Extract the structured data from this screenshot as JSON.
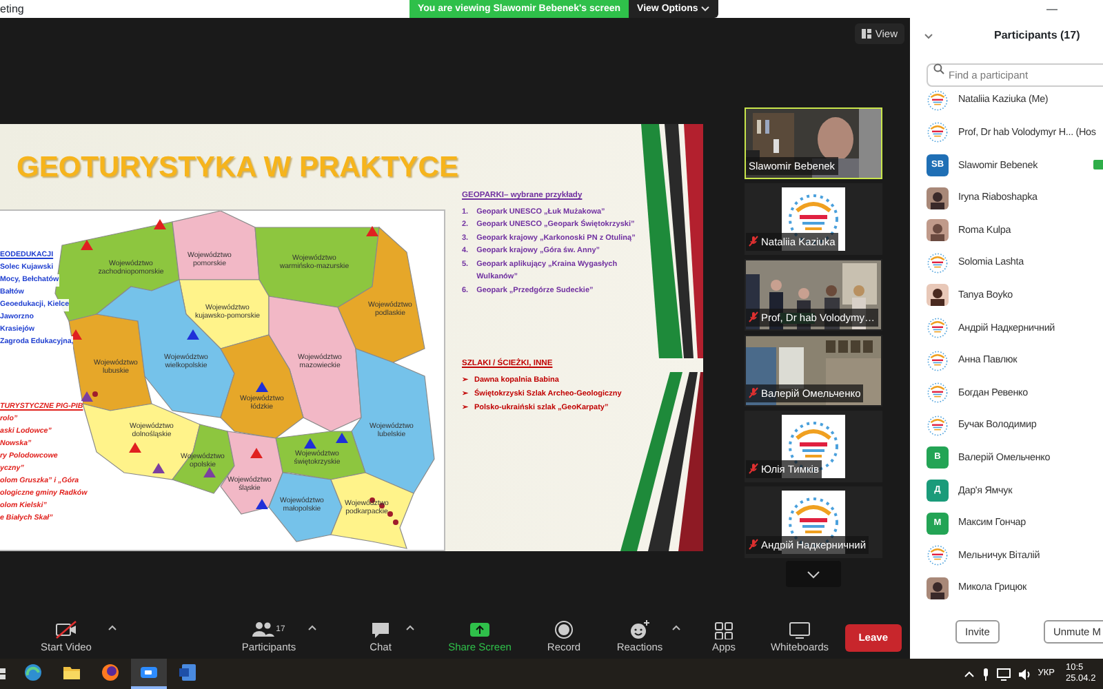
{
  "top_bar": {
    "window_title": "eting",
    "banner": "You are viewing Slawomir Bebenek's screen",
    "view_options": "View Options",
    "minimize": "—"
  },
  "view_button": "View",
  "slide": {
    "title": "GEOTURYSTYKA W PRAKTYCE",
    "regions": [
      {
        "label": "Województwo zachodniopomorskie",
        "color": "#8dc63f"
      },
      {
        "label": "Województwo pomorskie",
        "color": "#f2b8c6"
      },
      {
        "label": "Województwo warmińsko-mazurskie",
        "color": "#8dc63f"
      },
      {
        "label": "Województwo kujawsko-pomorskie",
        "color": "#fff38a"
      },
      {
        "label": "Województwo podlaskie",
        "color": "#e6a729"
      },
      {
        "label": "Województwo lubuskie",
        "color": "#e6a729"
      },
      {
        "label": "Województwo wielkopolskie",
        "color": "#75c2ea"
      },
      {
        "label": "Województwo mazowieckie",
        "color": "#f2b8c6"
      },
      {
        "label": "Województwo łódzkie",
        "color": "#e6a729"
      },
      {
        "label": "Województwo dolnośląskie",
        "color": "#fff38a"
      },
      {
        "label": "Województwo lubelskie",
        "color": "#75c2ea"
      },
      {
        "label": "Województwo opolskie",
        "color": "#8dc63f"
      },
      {
        "label": "Województwo świętokrzyskie",
        "color": "#8dc63f"
      },
      {
        "label": "Województwo śląskie",
        "color": "#f2b8c6"
      },
      {
        "label": "Województwo małopolskie",
        "color": "#75c2ea"
      },
      {
        "label": "Województwo podkarpackie",
        "color": "#fff38a"
      }
    ],
    "left_blue": {
      "heading": "EODEDUKACJI",
      "items": [
        "Solec Kujawski",
        "Mocy, Bełchatów",
        "Bałtów",
        "Geoedukacji, Kielce",
        "Jaworzno",
        "Krasiejów",
        "Zagroda Edukacyjna,"
      ]
    },
    "left_red": {
      "heading": "TURYSTYCZNE PIG-PIB",
      "items": [
        "rolo”",
        "aski Lodowce”",
        "Nowska”",
        "ry Polodowcowe",
        "yczny”",
        "olom Gruszka” i „Góra",
        "ologiczne gminy Radków",
        "olom Kielski”",
        "e Białych Skał”"
      ]
    },
    "geoparks": {
      "heading": "GEOPARKI– wybrane przykłady",
      "items": [
        {
          "number": "1.",
          "text": "Geopark UNESCO „Łuk Mużakowa”"
        },
        {
          "number": "2.",
          "text": "Geopark UNESCO „Geopark Świętokrzyski”"
        },
        {
          "number": "3.",
          "text": "Geopark krajowy „Karkonoski PN z Otuliną”"
        },
        {
          "number": "4.",
          "text": "Geopark krajowy „Góra św. Anny”"
        },
        {
          "number": "5.",
          "text": "Geopark aplikujący „Kraina Wygasłych Wulkanów”"
        },
        {
          "number": "6.",
          "text": "Geopark „Przedgórze Sudeckie”"
        }
      ]
    },
    "trails": {
      "heading": "SZLAKI / ŚCIEŻKI, INNE",
      "items": [
        {
          "marker": "➢",
          "text": "Dawna kopalnia Babina"
        },
        {
          "marker": "➢",
          "text": "Świętokrzyski Szlak Archeo-Geologiczny"
        },
        {
          "marker": "➢",
          "text": "Polsko-ukraiński szlak „GeoKarpaty”"
        }
      ]
    }
  },
  "thumbnails": [
    {
      "name": "Slawomir Bebenek",
      "kind": "video",
      "active": true,
      "muted": false
    },
    {
      "name": "Nataliia Kaziuka",
      "kind": "logo",
      "active": false,
      "muted": true
    },
    {
      "name": "Prof, Dr hab Volodymy…",
      "kind": "video",
      "active": false,
      "muted": true
    },
    {
      "name": "Валерій Омельченко",
      "kind": "video",
      "active": false,
      "muted": true
    },
    {
      "name": "Юлія Тимків",
      "kind": "logo",
      "active": false,
      "muted": true
    },
    {
      "name": "Андрій Надкерничний",
      "kind": "logo",
      "active": false,
      "muted": true
    }
  ],
  "participants": {
    "title": "Participants (17)",
    "search": {
      "placeholder": "Find a participant"
    },
    "items": [
      {
        "name": "Nataliia Kaziuka (Me)",
        "kind": "logo",
        "video_on": false
      },
      {
        "name": "Prof, Dr hab Volodymyr H... (Hos",
        "kind": "logo",
        "video_on": false
      },
      {
        "name": "Slawomir Bebenek",
        "kind": "initials",
        "initials": "SB",
        "color": "#1f6fb5",
        "video_on": true
      },
      {
        "name": "Iryna Riaboshapka",
        "video_on": false
      },
      {
        "name": "Roma Kulpa",
        "video_on": false
      },
      {
        "name": "Solomia Lashta",
        "kind": "logo",
        "video_on": false
      },
      {
        "name": "Tanya Boyko",
        "video_on": false
      },
      {
        "name": "Андрій Надкерничний",
        "kind": "logo",
        "video_on": false
      },
      {
        "name": "Анна Павлюк",
        "kind": "logo",
        "video_on": false
      },
      {
        "name": "Богдан Ревенко",
        "kind": "logo",
        "video_on": false
      },
      {
        "name": "Бучак Володимир",
        "kind": "logo",
        "video_on": false
      },
      {
        "name": "Валерій Омельченко",
        "kind": "initials",
        "initials": "В",
        "color": "#23a455",
        "video_on": false
      },
      {
        "name": "Дар'я Ямчук",
        "kind": "initials",
        "initials": "Д",
        "color": "#1a9b7a",
        "video_on": false
      },
      {
        "name": "Максим Гончар",
        "kind": "initials",
        "initials": "М",
        "color": "#23a455",
        "video_on": false
      },
      {
        "name": "Мельничук Віталій",
        "kind": "logo",
        "video_on": false
      },
      {
        "name": "Микола Грицюк",
        "video_on": false
      }
    ],
    "buttons": [
      "Invite",
      "Unmute M"
    ]
  },
  "toolbar": {
    "items": [
      {
        "kind": "video",
        "label": "Start Video",
        "caret": true
      },
      {
        "kind": "participants",
        "label": "Participants",
        "count": "17",
        "caret": true
      },
      {
        "kind": "chat",
        "label": "Chat",
        "caret": true
      },
      {
        "kind": "share",
        "label": "Share Screen",
        "caret": false
      },
      {
        "kind": "record",
        "label": "Record",
        "caret": false
      },
      {
        "kind": "reactions",
        "label": "Reactions",
        "caret": true
      },
      {
        "kind": "apps",
        "label": "Apps",
        "caret": false
      },
      {
        "kind": "whiteboards",
        "label": "Whiteboards",
        "caret": false
      }
    ],
    "leave": "Leave"
  },
  "taskbar": {
    "apps": [
      {
        "kind": "browser",
        "active": false
      },
      {
        "kind": "folder",
        "active": false
      },
      {
        "kind": "firefox",
        "active": false
      },
      {
        "kind": "zoom",
        "active": true
      },
      {
        "kind": "word",
        "active": false
      }
    ],
    "language": "УКР",
    "time": "10:5",
    "date": "25.04.2"
  }
}
